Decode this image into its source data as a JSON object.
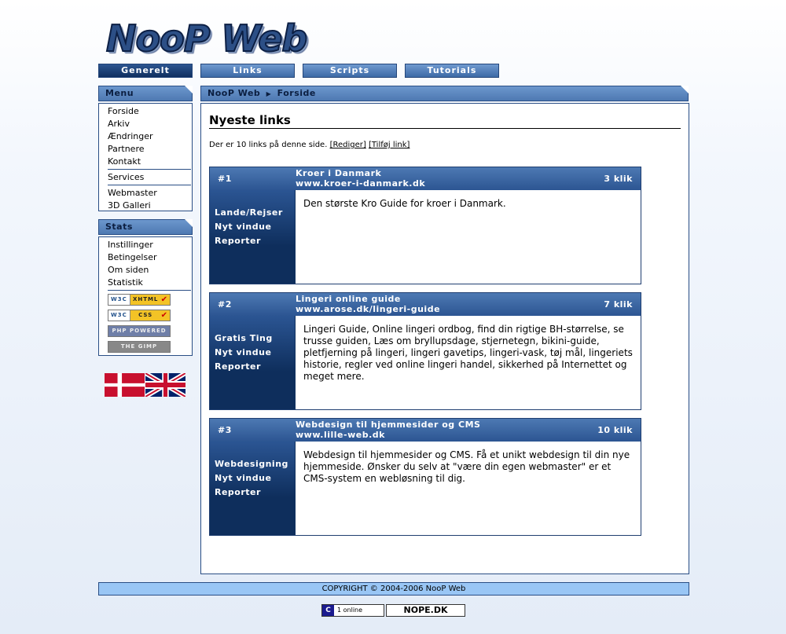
{
  "logo_text": "NooP Web",
  "topnav": [
    {
      "label": "Generelt",
      "active": true
    },
    {
      "label": "Links",
      "active": false
    },
    {
      "label": "Scripts",
      "active": false
    },
    {
      "label": "Tutorials",
      "active": false
    }
  ],
  "menu": {
    "title": "Menu",
    "group1": [
      "Forside",
      "Arkiv",
      "Ændringer",
      "Partnere",
      "Kontakt"
    ],
    "group2": [
      "Services"
    ],
    "group3": [
      "Webmaster",
      "3D Galleri"
    ]
  },
  "stats": {
    "title": "Stats",
    "items": [
      "Instillinger",
      "Betingelser",
      "Om siden",
      "Statistik"
    ],
    "badges": {
      "xhtml_w3c": "W3C",
      "xhtml": "XHTML 1.0",
      "css_w3c": "W3C",
      "css": "CSS",
      "php": "PHP POWERED",
      "gimp": "THE GIMP"
    }
  },
  "flags": [
    "danish-flag",
    "uk-flag"
  ],
  "breadcrumb": {
    "root": "NooP Web",
    "current": "Forside"
  },
  "content": {
    "heading": "Nyeste links",
    "intro": "Der er 10 links på denne side.",
    "edit_link": "[Rediger]",
    "add_link": "[Tilføj link]"
  },
  "links": [
    {
      "num": "#1",
      "title": "Kroer i Danmark",
      "url": "www.kroer-i-danmark.dk",
      "clicks": "3 klik",
      "category": "Lande/Rejser",
      "new_window": "Nyt vindue",
      "report": "Reporter",
      "description": "Den største Kro Guide for kroer i Danmark."
    },
    {
      "num": "#2",
      "title": "Lingeri online guide",
      "url": "www.arose.dk/lingeri-guide",
      "clicks": "7 klik",
      "category": "Gratis Ting",
      "new_window": "Nyt vindue",
      "report": "Reporter",
      "description": "Lingeri Guide, Online lingeri ordbog, find din rigtige BH-størrelse, se trusse guiden, Læs om bryllupsdage, stjernetegn, bikini-guide, pletfjerning på lingeri, lingeri gavetips, lingeri-vask, tøj mål, lingeriets historie, regler ved online lingeri handel, sikkerhed på Internettet og meget mere."
    },
    {
      "num": "#3",
      "title": "Webdesign til hjemmesider og CMS",
      "url": "www.lille-web.dk",
      "clicks": "10 klik",
      "category": "Webdesigning",
      "new_window": "Nyt vindue",
      "report": "Reporter",
      "description": "Webdesign til hjemmesider og CMS. Få et unikt webdesign til din nye hjemmeside. Ønsker du selv at \"være din egen webmaster\" er et CMS-system en webløsning til dig."
    }
  ],
  "footer": {
    "copyright": "COPYRIGHT © 2004-2006 NooP Web",
    "online_icon": "C",
    "online": "1 online",
    "nope": "NOPE.DK"
  },
  "colors": {
    "accent": "#2c5592",
    "dark": "#12325f",
    "footer_bg": "#99c6f5"
  }
}
